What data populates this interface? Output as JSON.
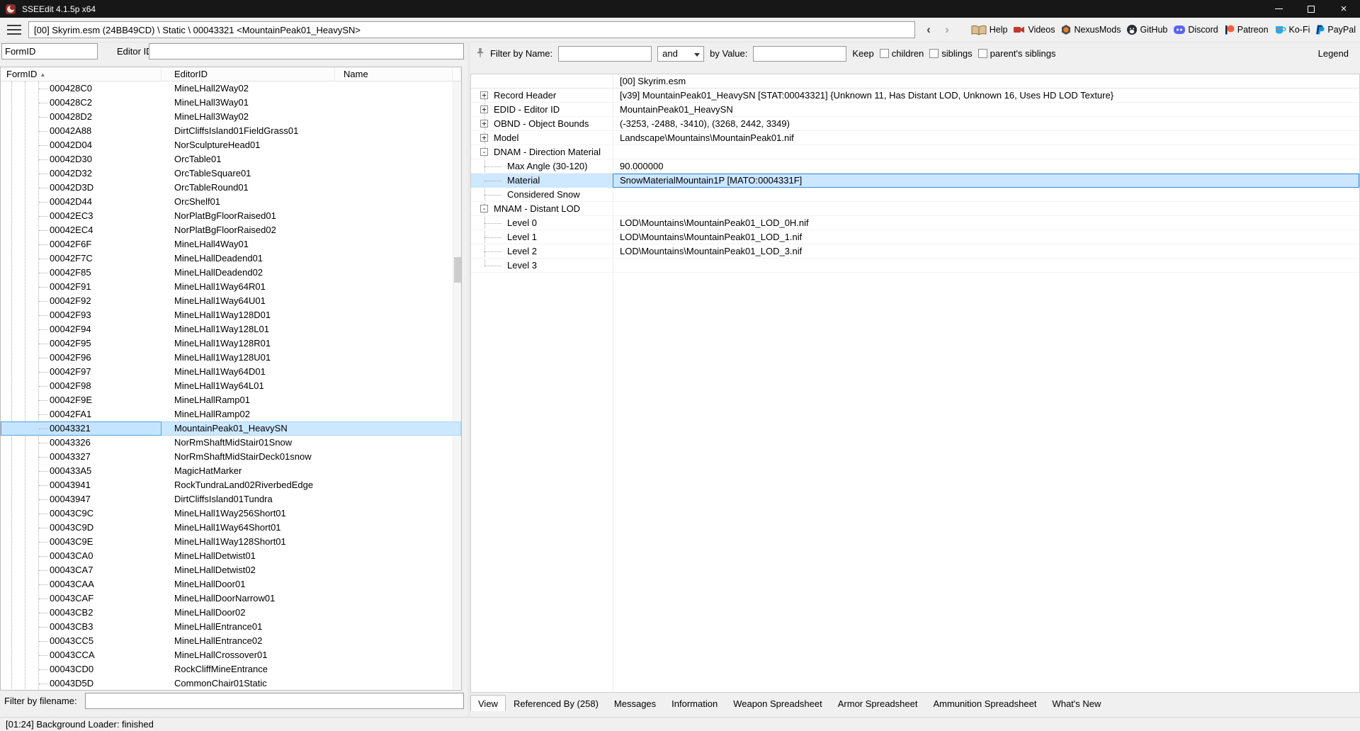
{
  "window": {
    "title": "SSEEdit 4.1.5p x64"
  },
  "toolbar": {
    "breadcrumb": "[00] Skyrim.esm (24BB49CD) \\ Static \\ 00043321 <MountainPeak01_HeavySN>",
    "nav_back": "‹",
    "nav_forward": "›",
    "links": [
      {
        "label": "Help"
      },
      {
        "label": "Videos"
      },
      {
        "label": "NexusMods"
      },
      {
        "label": "GitHub"
      },
      {
        "label": "Discord"
      },
      {
        "label": "Patreon"
      },
      {
        "label": "Ko-Fi"
      },
      {
        "label": "PayPal"
      }
    ]
  },
  "left_panel": {
    "formid_label": "FormID",
    "editor_id_label": "Editor ID",
    "columns": {
      "formid": "FormID",
      "editorid": "EditorID",
      "name": "Name"
    },
    "sort_indicator": "▲",
    "selected_formid": "00043321",
    "filter_label": "Filter by filename:",
    "filter_value": "",
    "rows": [
      {
        "formid": "000428C0",
        "editorid": "MineLHall2Way02",
        "name": ""
      },
      {
        "formid": "000428C2",
        "editorid": "MineLHall3Way01",
        "name": ""
      },
      {
        "formid": "000428D2",
        "editorid": "MineLHall3Way02",
        "name": ""
      },
      {
        "formid": "00042A88",
        "editorid": "DirtCliffsIsland01FieldGrass01",
        "name": ""
      },
      {
        "formid": "00042D04",
        "editorid": "NorSculptureHead01",
        "name": ""
      },
      {
        "formid": "00042D30",
        "editorid": "OrcTable01",
        "name": ""
      },
      {
        "formid": "00042D32",
        "editorid": "OrcTableSquare01",
        "name": ""
      },
      {
        "formid": "00042D3D",
        "editorid": "OrcTableRound01",
        "name": ""
      },
      {
        "formid": "00042D44",
        "editorid": "OrcShelf01",
        "name": ""
      },
      {
        "formid": "00042EC3",
        "editorid": "NorPlatBgFloorRaised01",
        "name": ""
      },
      {
        "formid": "00042EC4",
        "editorid": "NorPlatBgFloorRaised02",
        "name": ""
      },
      {
        "formid": "00042F6F",
        "editorid": "MineLHall4Way01",
        "name": ""
      },
      {
        "formid": "00042F7C",
        "editorid": "MineLHallDeadend01",
        "name": ""
      },
      {
        "formid": "00042F85",
        "editorid": "MineLHallDeadend02",
        "name": ""
      },
      {
        "formid": "00042F91",
        "editorid": "MineLHall1Way64R01",
        "name": ""
      },
      {
        "formid": "00042F92",
        "editorid": "MineLHall1Way64U01",
        "name": ""
      },
      {
        "formid": "00042F93",
        "editorid": "MineLHall1Way128D01",
        "name": ""
      },
      {
        "formid": "00042F94",
        "editorid": "MineLHall1Way128L01",
        "name": ""
      },
      {
        "formid": "00042F95",
        "editorid": "MineLHall1Way128R01",
        "name": ""
      },
      {
        "formid": "00042F96",
        "editorid": "MineLHall1Way128U01",
        "name": ""
      },
      {
        "formid": "00042F97",
        "editorid": "MineLHall1Way64D01",
        "name": ""
      },
      {
        "formid": "00042F98",
        "editorid": "MineLHall1Way64L01",
        "name": ""
      },
      {
        "formid": "00042F9E",
        "editorid": "MineLHallRamp01",
        "name": ""
      },
      {
        "formid": "00042FA1",
        "editorid": "MineLHallRamp02",
        "name": ""
      },
      {
        "formid": "00043321",
        "editorid": "MountainPeak01_HeavySN",
        "name": ""
      },
      {
        "formid": "00043326",
        "editorid": "NorRmShaftMidStair01Snow",
        "name": ""
      },
      {
        "formid": "00043327",
        "editorid": "NorRmShaftMidStairDeck01snow",
        "name": ""
      },
      {
        "formid": "000433A5",
        "editorid": "MagicHatMarker",
        "name": ""
      },
      {
        "formid": "00043941",
        "editorid": "RockTundraLand02RiverbedEdge",
        "name": ""
      },
      {
        "formid": "00043947",
        "editorid": "DirtCliffsIsland01Tundra",
        "name": ""
      },
      {
        "formid": "00043C9C",
        "editorid": "MineLHall1Way256Short01",
        "name": ""
      },
      {
        "formid": "00043C9D",
        "editorid": "MineLHall1Way64Short01",
        "name": ""
      },
      {
        "formid": "00043C9E",
        "editorid": "MineLHall1Way128Short01",
        "name": ""
      },
      {
        "formid": "00043CA0",
        "editorid": "MineLHallDetwist01",
        "name": ""
      },
      {
        "formid": "00043CA7",
        "editorid": "MineLHallDetwist02",
        "name": ""
      },
      {
        "formid": "00043CAA",
        "editorid": "MineLHallDoor01",
        "name": ""
      },
      {
        "formid": "00043CAF",
        "editorid": "MineLHallDoorNarrow01",
        "name": ""
      },
      {
        "formid": "00043CB2",
        "editorid": "MineLHallDoor02",
        "name": ""
      },
      {
        "formid": "00043CB3",
        "editorid": "MineLHallEntrance01",
        "name": ""
      },
      {
        "formid": "00043CC5",
        "editorid": "MineLHallEntrance02",
        "name": ""
      },
      {
        "formid": "00043CCA",
        "editorid": "MineLHallCrossover01",
        "name": ""
      },
      {
        "formid": "00043CD0",
        "editorid": "RockCliffMineEntrance",
        "name": ""
      },
      {
        "formid": "00043D5D",
        "editorid": "CommonChair01Static",
        "name": ""
      }
    ]
  },
  "right_panel": {
    "filter": {
      "name_label": "Filter by Name:",
      "name_value": "",
      "operator": "and",
      "value_label": "by Value:",
      "value_value": "",
      "keep_label": "Keep",
      "options": [
        "children",
        "siblings",
        "parent's siblings"
      ],
      "legend_label": "Legend"
    },
    "view": {
      "column_header": "[00] Skyrim.esm",
      "rows": [
        {
          "label": "Record Header",
          "value": "[v39] MountainPeak01_HeavySN [STAT:00043321] {Unknown 11, Has Distant LOD, Unknown 16, Uses HD LOD Texture}",
          "expander": "+",
          "depth": 0
        },
        {
          "label": "EDID - Editor ID",
          "value": "MountainPeak01_HeavySN",
          "expander": "+",
          "depth": 0
        },
        {
          "label": "OBND - Object Bounds",
          "value": "(-3253, -2488, -3410), (3268, 2442, 3349)",
          "expander": "+",
          "depth": 0
        },
        {
          "label": "Model",
          "value": "Landscape\\Mountains\\MountainPeak01.nif",
          "expander": "+",
          "depth": 0
        },
        {
          "label": "DNAM - Direction Material",
          "value": "",
          "expander": "-",
          "depth": 0
        },
        {
          "label": "Max Angle (30-120)",
          "value": "90.000000",
          "expander": "",
          "depth": 1
        },
        {
          "label": "Material",
          "value": "SnowMaterialMountain1P [MATO:0004331F]",
          "expander": "",
          "depth": 1,
          "selected": true
        },
        {
          "label": "Considered Snow",
          "value": "",
          "expander": "",
          "depth": 1
        },
        {
          "label": "MNAM - Distant LOD",
          "value": "",
          "expander": "-",
          "depth": 0
        },
        {
          "label": "Level 0",
          "value": "LOD\\Mountains\\MountainPeak01_LOD_0H.nif",
          "expander": "",
          "depth": 1
        },
        {
          "label": "Level 1",
          "value": "LOD\\Mountains\\MountainPeak01_LOD_1.nif",
          "expander": "",
          "depth": 1
        },
        {
          "label": "Level 2",
          "value": "LOD\\Mountains\\MountainPeak01_LOD_3.nif",
          "expander": "",
          "depth": 1
        },
        {
          "label": "Level 3",
          "value": "",
          "expander": "",
          "depth": 1
        }
      ]
    },
    "tabs": [
      "View",
      "Referenced By (258)",
      "Messages",
      "Information",
      "Weapon Spreadsheet",
      "Armor Spreadsheet",
      "Ammunition Spreadsheet",
      "What's New"
    ],
    "active_tab": "View"
  },
  "status_bar": {
    "text": "[01:24] Background Loader: finished"
  }
}
